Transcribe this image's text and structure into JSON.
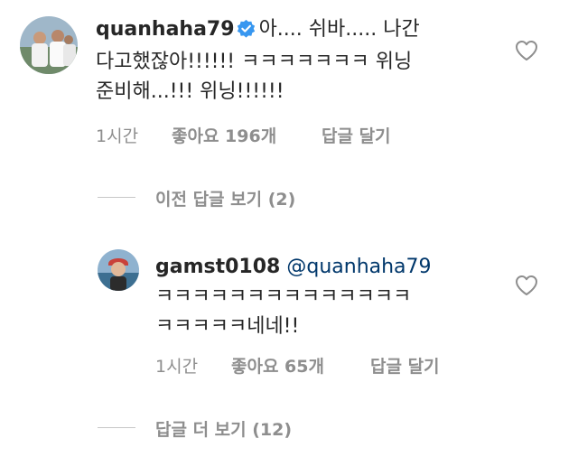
{
  "comments": [
    {
      "username": "quanhaha79",
      "verified": true,
      "lines": [
        "아.... 쉬바..... 나간",
        "다고했잖아!!!!!! ㅋㅋㅋㅋㅋㅋㅋ 위닝",
        "준비해...!!! 위닝!!!!!!"
      ],
      "time": "1시간",
      "likes": "좋아요 196개",
      "reply_label": "답글 달기"
    },
    {
      "username": "gamst0108",
      "verified": false,
      "mention": "@quanhaha79",
      "lines": [
        "ㅋㅋㅋㅋㅋㅋㅋㅋㅋㅋㅋㅋㅋㅋ",
        "ㅋㅋㅋㅋㅋ네네!!"
      ],
      "time": "1시간",
      "likes": "좋아요 65개",
      "reply_label": "답글 달기"
    }
  ],
  "toggles": {
    "previous_replies": "이전 답글 보기 (2)",
    "more_replies": "답글 더 보기 (12)"
  },
  "colors": {
    "text": "#262626",
    "secondary": "#8e8e8e",
    "mention": "#00376b",
    "verified": "#3897f0"
  }
}
